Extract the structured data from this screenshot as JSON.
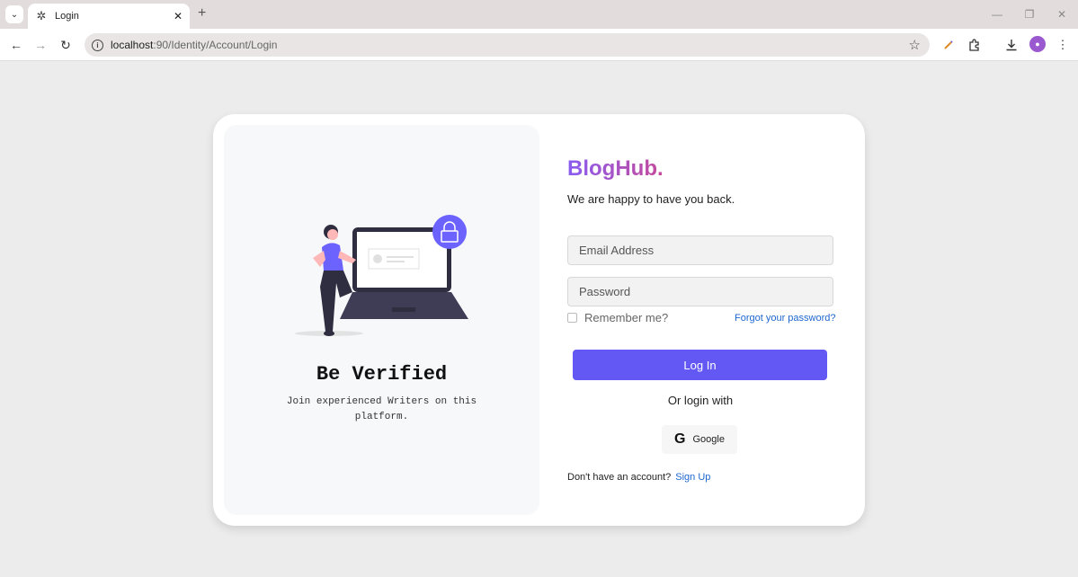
{
  "browser": {
    "tab_title": "Login",
    "url_host": "localhost",
    "url_path": ":90/Identity/Account/Login",
    "new_tab": "+",
    "win_minimize": "—",
    "win_restore": "❐",
    "win_close": "✕",
    "tab_close": "✕",
    "tab_menu": "⌄",
    "back": "←",
    "forward": "→",
    "reload": "↻",
    "star": "☆",
    "info": "i",
    "extensions_icon": "puzzle-icon",
    "download_icon": "download-icon",
    "menu_icon": "⋮"
  },
  "left_panel": {
    "title": "Be Verified",
    "subtitle": "Join experienced Writers on this platform."
  },
  "form": {
    "brand": "BlogHub.",
    "welcome": "We are happy to have you back.",
    "email_placeholder": "Email Address",
    "password_placeholder": "Password",
    "remember_label": "Remember me?",
    "forgot_label": "Forgot your password?",
    "login_label": "Log In",
    "or_login": "Or login with",
    "google_icon": "G",
    "google_label": "Google",
    "no_account": "Don't have an account?",
    "signup_label": "Sign Up"
  },
  "colors": {
    "primary": "#6358f4",
    "link": "#1e66d0",
    "brand_start": "#8a5cf0",
    "brand_end": "#c54a9b"
  }
}
